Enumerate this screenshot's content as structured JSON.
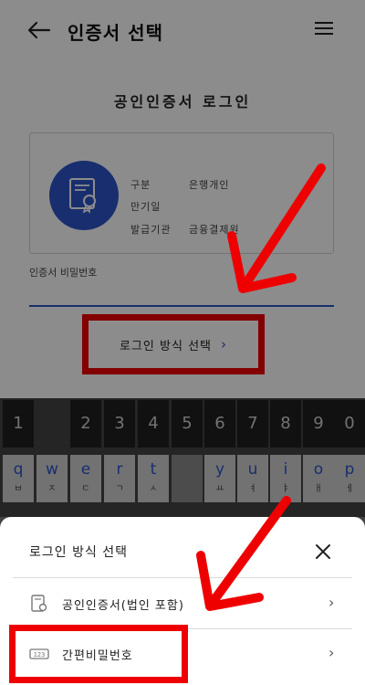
{
  "appbar": {
    "title": "인증서 선택",
    "back_icon": "arrow-left-icon",
    "menu_icon": "hamburger-menu-icon"
  },
  "login": {
    "heading": "공인인증서 로그인",
    "cert": {
      "icon": "certificate-icon",
      "type_label": "구분",
      "type_value": "은행개인",
      "expiry_label": "만기일",
      "expiry_value": "",
      "issuer_label": "발급기관",
      "issuer_value": "금융결제원"
    },
    "password_label": "인증서 비밀번호",
    "password_value": "",
    "method_button_label": "로그인 방식 선택",
    "method_button_icon": "chevron-right-icon"
  },
  "keyboard": {
    "number_keys": [
      "1",
      "2",
      "3",
      "4",
      "5",
      "6",
      "7",
      "8",
      "9",
      "0"
    ],
    "letter_keys": [
      {
        "letter": "q",
        "hangul": "ㅂ"
      },
      {
        "letter": "w",
        "hangul": "ㅈ"
      },
      {
        "letter": "e",
        "hangul": "ㄷ"
      },
      {
        "letter": "r",
        "hangul": "ㄱ"
      },
      {
        "letter": "t",
        "hangul": "ㅅ"
      },
      {
        "letter": "y",
        "hangul": "ㅛ"
      },
      {
        "letter": "u",
        "hangul": "ㅕ"
      },
      {
        "letter": "i",
        "hangul": "ㅑ"
      },
      {
        "letter": "o",
        "hangul": "ㅐ"
      },
      {
        "letter": "p",
        "hangul": "ㅔ"
      }
    ]
  },
  "sheet": {
    "title": "로그인 방식 선택",
    "close_icon": "close-icon",
    "options": [
      {
        "label": "공인인증서(법인 포함)",
        "icon": "certificate-icon",
        "chevron": "chevron-right-icon"
      },
      {
        "label": "간편비밀번호",
        "icon": "pin-keypad-icon",
        "chevron": "chevron-right-icon"
      }
    ]
  },
  "colors": {
    "accent": "#2c54c9",
    "highlight": "#ee0000",
    "overlay": "#000000"
  }
}
